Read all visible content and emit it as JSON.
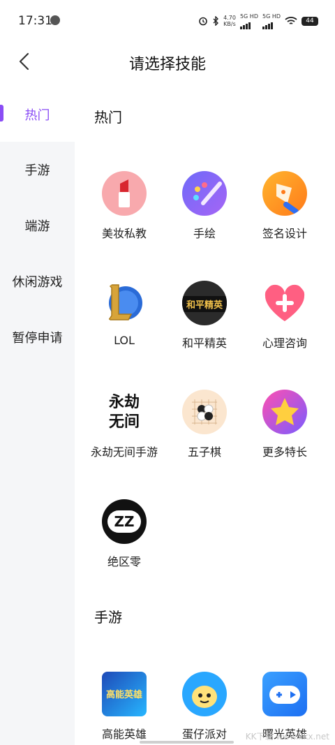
{
  "status": {
    "time": "17:31",
    "net_speed": "4.70",
    "net_unit": "KB/s",
    "sim1": "5G HD",
    "sim2": "5G HD",
    "battery": "44"
  },
  "header": {
    "title": "请选择技能"
  },
  "sidebar": {
    "items": [
      {
        "label": "热门"
      },
      {
        "label": "手游"
      },
      {
        "label": "端游"
      },
      {
        "label": "休闲游戏"
      },
      {
        "label": "暂停申请"
      }
    ]
  },
  "sections": [
    {
      "title": "热门",
      "skills": [
        {
          "label": "美妆私教"
        },
        {
          "label": "手绘"
        },
        {
          "label": "签名设计"
        },
        {
          "label": "LOL"
        },
        {
          "label": "和平精英"
        },
        {
          "label": "心理咨询"
        },
        {
          "label": "永劫无间手游"
        },
        {
          "label": "五子棋"
        },
        {
          "label": "更多特长"
        },
        {
          "label": "绝区零"
        }
      ]
    },
    {
      "title": "手游",
      "skills": [
        {
          "label": "高能英雄"
        },
        {
          "label": "蛋仔派对"
        },
        {
          "label": "曙光英雄"
        }
      ]
    }
  ],
  "icon_texts": {
    "peace_elite": "和平精英",
    "naraka_a": "永劫",
    "naraka_b": "无间",
    "zzz": "ZZ",
    "high_energy": "高能英雄"
  },
  "watermark": "KK下载 www.kkx.net",
  "colors": {
    "accent": "#8a4df5"
  }
}
